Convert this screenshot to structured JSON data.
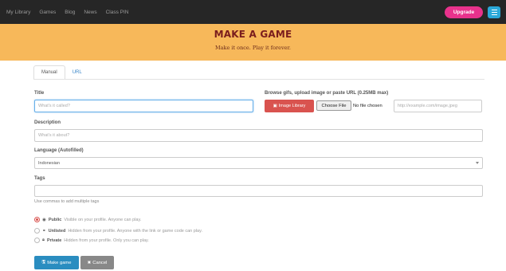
{
  "nav": {
    "links": [
      "My Library",
      "Games",
      "Blog",
      "News",
      "Class PIN"
    ],
    "upgrade_label": "Upgrade",
    "menu_icon": "hamburger-menu-icon"
  },
  "banner": {
    "title": "MAKE A GAME",
    "subtitle": "Make it once. Play it forever."
  },
  "tabs": [
    {
      "label": "Manual",
      "active": true
    },
    {
      "label": "URL",
      "active": false
    }
  ],
  "form": {
    "title": {
      "label": "Title",
      "placeholder": "What's it called?",
      "value": ""
    },
    "image": {
      "label": "Browse gifs, upload image or paste URL (0.25MB max)",
      "library_button": "Image Library",
      "library_icon": "image-icon",
      "file_button": "Choose File",
      "file_status": "No file chosen",
      "url_placeholder": "http://example.com/image.jpeg"
    },
    "description": {
      "label": "Description",
      "placeholder": "What's it about?"
    },
    "language": {
      "label": "Language (Autofilled)",
      "value": "Indonesian"
    },
    "tags": {
      "label": "Tags",
      "value": "",
      "help": "Use commas to add multiple tags"
    },
    "visibility": [
      {
        "icon": "eye-icon",
        "glyph": "◉",
        "name": "Public",
        "desc": "Visible on your profile. Anyone can play.",
        "checked": true
      },
      {
        "icon": "link-icon",
        "glyph": "⚭",
        "name": "Unlisted",
        "desc": "Hidden from your profile. Anyone with the link or game code can play.",
        "checked": false
      },
      {
        "icon": "lock-icon",
        "glyph": "🔒︎",
        "name": "Private",
        "desc": "Hidden from your profile. Only you can play.",
        "checked": false
      }
    ]
  },
  "actions": {
    "submit_label": "Make game",
    "submit_icon": "save-icon",
    "cancel_label": "Cancel",
    "cancel_icon": "close-icon"
  },
  "colors": {
    "nav_bg": "#262626",
    "banner_bg": "#f7b85a",
    "banner_title": "#7a1d1d",
    "upgrade": "#e8328c",
    "menu": "#2aa8d9",
    "danger": "#d9534f",
    "primary": "#2a8dc0"
  }
}
